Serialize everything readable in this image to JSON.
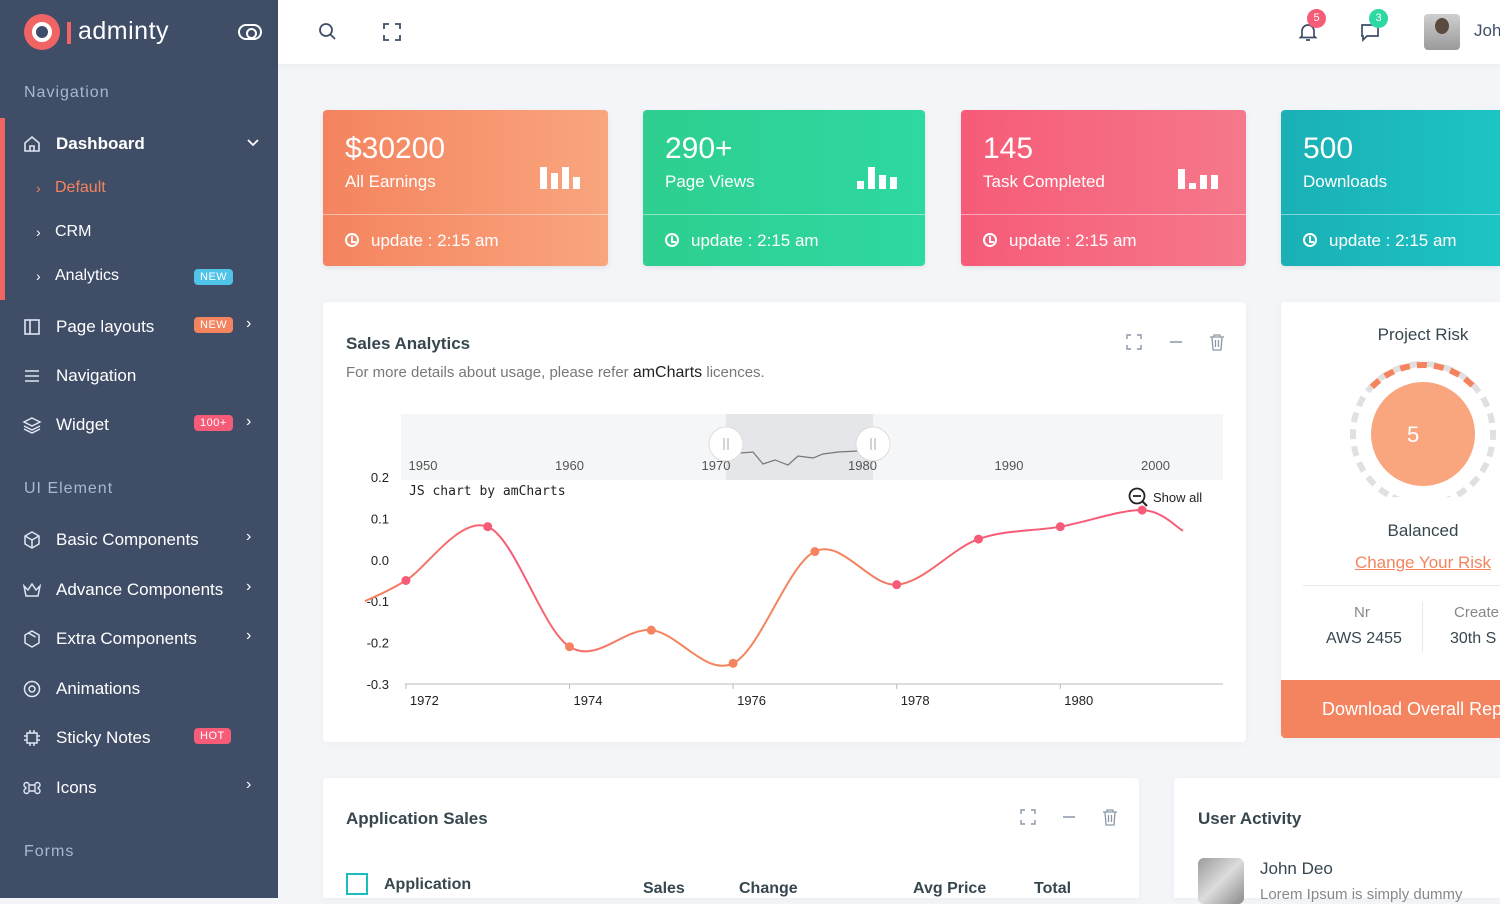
{
  "brand": {
    "name": "adminty"
  },
  "sidebar": {
    "captions": {
      "navigation": "Navigation",
      "ui_element": "UI Element",
      "forms": "Forms"
    },
    "dashboard": {
      "label": "Dashboard",
      "icon": "home-icon",
      "sub": [
        {
          "label": "Default",
          "active": true
        },
        {
          "label": "CRM"
        },
        {
          "label": "Analytics",
          "badge": "NEW"
        }
      ]
    },
    "items": [
      {
        "label": "Page layouts",
        "icon": "layout-icon",
        "badge": "NEW"
      },
      {
        "label": "Navigation",
        "icon": "menu-icon"
      },
      {
        "label": "Widget",
        "icon": "layers-icon",
        "badge": "100+"
      },
      {
        "label": "Basic Components",
        "icon": "box-icon"
      },
      {
        "label": "Advance Components",
        "icon": "crown-icon"
      },
      {
        "label": "Extra Components",
        "icon": "package-icon"
      },
      {
        "label": "Animations",
        "icon": "aperture-icon"
      },
      {
        "label": "Sticky Notes",
        "icon": "cpu-icon",
        "badge": "HOT"
      },
      {
        "label": "Icons",
        "icon": "command-icon"
      }
    ]
  },
  "topbar": {
    "notifications": "5",
    "messages": "3",
    "user": "John Doe"
  },
  "stats": [
    {
      "value": "$30200",
      "label": "All Earnings",
      "update": "update : 2:15 am",
      "color": "#f4845f"
    },
    {
      "value": "290+",
      "label": "Page Views",
      "update": "update : 2:15 am",
      "color": "#2ed8a2"
    },
    {
      "value": "145",
      "label": "Task Completed",
      "update": "update : 2:15 am",
      "color": "#f65b78"
    },
    {
      "value": "500",
      "label": "Downloads",
      "update": "update : 2:15 am",
      "color": "#1abdbd"
    }
  ],
  "sales_analytics": {
    "title": "Sales Analytics",
    "desc_before": "For more details about usage, please refer",
    "desc_link": "amCharts",
    "desc_after": "licences.",
    "credit": "JS chart by amCharts",
    "show_all": "Show all"
  },
  "chart_data": {
    "type": "line",
    "x": [
      1971.5,
      1972.0,
      1973.0,
      1974.0,
      1975.0,
      1976.0,
      1977.0,
      1978.0,
      1979.0,
      1980.0,
      1981.0,
      1981.5
    ],
    "y": [
      -0.1,
      -0.05,
      0.08,
      -0.21,
      -0.17,
      -0.25,
      0.02,
      -0.06,
      0.05,
      0.08,
      0.12,
      0.07
    ],
    "xticks": [
      "1972",
      "1974",
      "1976",
      "1978",
      "1980"
    ],
    "yticks": [
      "0.2",
      "0.1",
      "0.0",
      "-0.1",
      "-0.2",
      "-0.3"
    ],
    "ylim": [
      -0.3,
      0.2
    ],
    "scrollbar_ticks": [
      "1950",
      "1960",
      "1970",
      "1980",
      "1990",
      "2000"
    ],
    "grid": false
  },
  "project_risk": {
    "title": "Project Risk",
    "score": "5",
    "status": "Balanced",
    "link": "Change Your Risk",
    "nr_label": "Nr",
    "nr_value": "AWS 2455",
    "created_label": "Create",
    "created_value": "30th S",
    "button": "Download Overall Rep"
  },
  "application_sales": {
    "title": "Application Sales",
    "columns": [
      "Application",
      "Sales",
      "Change",
      "Avg Price",
      "Total"
    ]
  },
  "user_activity": {
    "title": "User Activity",
    "name": "John Deo",
    "text": "Lorem Ipsum is simply dummy"
  },
  "colors": {
    "sidebar": "#3f4d67",
    "accent": "#f06464",
    "line": "#f65b78",
    "line2": "#f4845f"
  }
}
